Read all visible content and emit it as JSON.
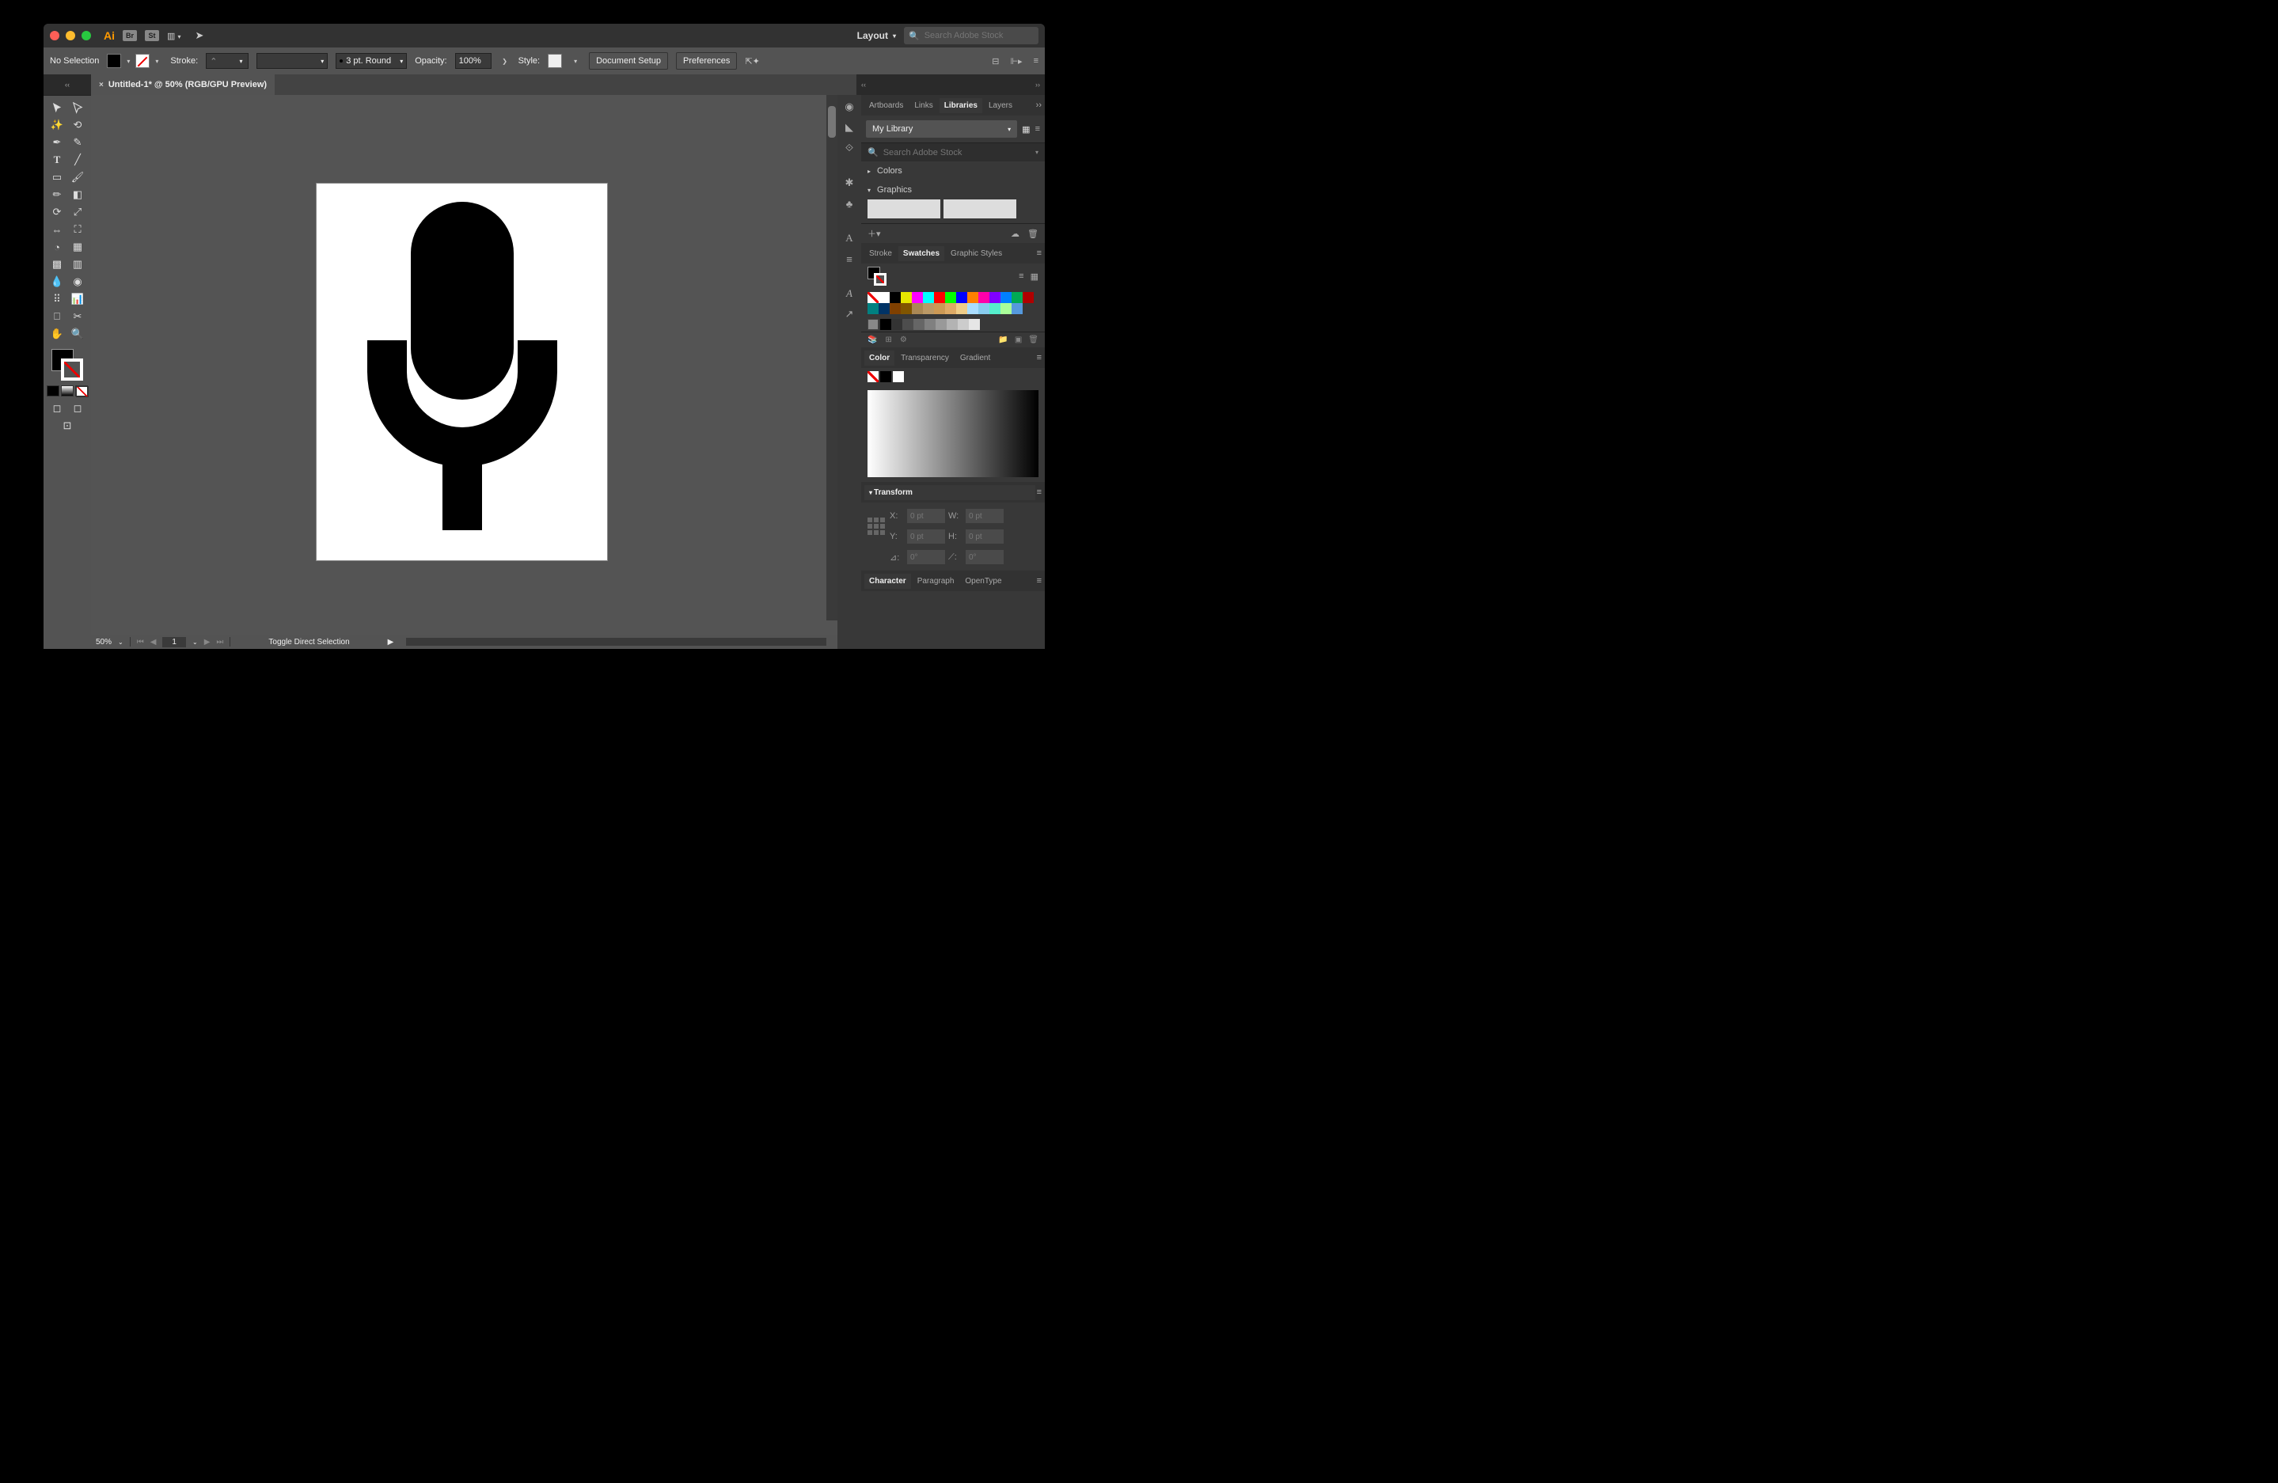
{
  "title_bar": {
    "workspace_label": "Layout",
    "search_placeholder": "Search Adobe Stock",
    "bridge_label": "Br",
    "stock_label": "St"
  },
  "control_bar": {
    "selection_status": "No Selection",
    "stroke_label": "Stroke:",
    "stroke_weight": "",
    "brush_label": "3 pt. Round",
    "opacity_label": "Opacity:",
    "opacity_value": "100%",
    "style_label": "Style:",
    "doc_setup_btn": "Document Setup",
    "prefs_btn": "Preferences"
  },
  "document": {
    "tab_title": "Untitled-1* @ 50% (RGB/GPU Preview)"
  },
  "status_bar": {
    "zoom": "50%",
    "artboard_num": "1",
    "hint": "Toggle Direct Selection"
  },
  "panels": {
    "libraries": {
      "tabs": [
        "Artboards",
        "Links",
        "Libraries",
        "Layers"
      ],
      "active_tab": 2,
      "dropdown": "My Library",
      "search_placeholder": "Search Adobe Stock",
      "sections": {
        "colors": "Colors",
        "graphics": "Graphics"
      }
    },
    "swatches": {
      "tabs": [
        "Stroke",
        "Swatches",
        "Graphic Styles"
      ],
      "active_tab": 1,
      "row1": [
        "#ffffff00",
        "#ffffff",
        "#000000",
        "#e6e600",
        "#ff00ff",
        "#00ffff",
        "#ff0000",
        "#00ff00",
        "#0000ff",
        "#ff8000",
        "#ff00aa",
        "#8000ff",
        "#0080ff",
        "#00aa55"
      ],
      "row2": [
        "#b00000",
        "#008080",
        "#003366",
        "#804000",
        "#805500",
        "#aa8855",
        "#bb9966",
        "#cc9955",
        "#ddaa66",
        "#eecc88",
        "#aaddff",
        "#88ccee",
        "#55eecc",
        "#aaff99"
      ],
      "row3": [
        "#5599dd"
      ],
      "grays": [
        "#000000",
        "#333333",
        "#4d4d4d",
        "#666666",
        "#808080",
        "#999999",
        "#b3b3b3",
        "#cccccc",
        "#e6e6e6"
      ]
    },
    "color": {
      "tabs": [
        "Color",
        "Transparency",
        "Gradient"
      ],
      "active_tab": 0
    },
    "transform": {
      "title": "Transform",
      "x_label": "X:",
      "y_label": "Y:",
      "w_label": "W:",
      "h_label": "H:",
      "x_val": "0 pt",
      "y_val": "0 pt",
      "w_val": "0 pt",
      "h_val": "0 pt",
      "angle_label": "⊿:",
      "angle_val": "0°",
      "shear_label": "⟋:",
      "shear_val": "0°"
    },
    "type": {
      "tabs": [
        "Character",
        "Paragraph",
        "OpenType"
      ],
      "active_tab": 0
    }
  }
}
